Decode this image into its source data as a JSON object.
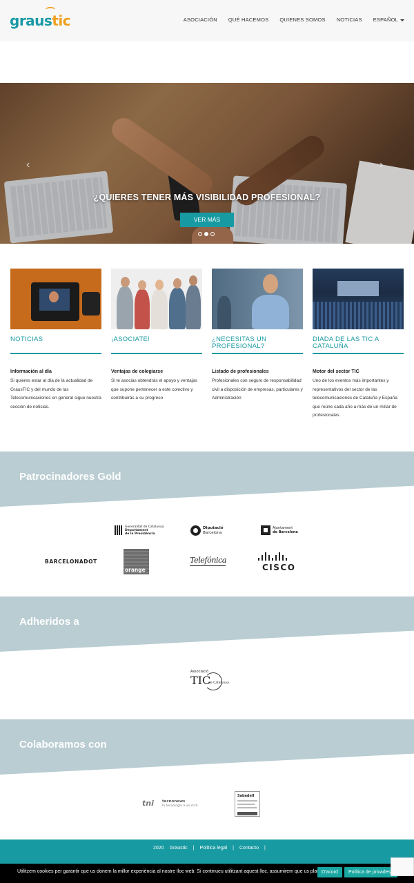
{
  "header": {
    "logo_part1": "graus",
    "logo_part2": "tic",
    "nav": [
      "ASOCIACIÓN",
      "QUÉ HACEMOS",
      "QUIENES SOMOS",
      "NOTICIAS",
      "ESPAÑOL"
    ]
  },
  "hero": {
    "title": "¿QUIERES TENER MÁS VISIBILIDAD PROFESIONAL?",
    "button": "VER MÁS",
    "slides": 3,
    "active_slide": 1
  },
  "cards": [
    {
      "title": "NOTICIAS",
      "subtitle": "Información al día",
      "text": "Si quieres estar al día de la actualidad de GrausTIC y del mundo de las Telecomunicaciones en general sigue nuestra sección de noticias."
    },
    {
      "title": "¡ASOCIATE!",
      "subtitle": "Ventajas de colegiarse",
      "text": "Si te asocias obtendrás el apoyo y ventajas que supone pertenecer a este colectivo y contribuirás a su progreso"
    },
    {
      "title": "¿NECESITAS UN PROFESIONAL?",
      "subtitle": "Listado de profesionales",
      "text": "Profesionales con seguro de responsabilidad civil a disposición de empresas, particulares y Administración"
    },
    {
      "title": "DIADA DE LAS TIC A CATALUÑA",
      "subtitle": "Motor del sector TIC",
      "text": "Uno de los eventos más importantes y representativos del sector de las telecomunicaciones de Cataluña y España que reúne cada año a más de un millar de profesionales"
    }
  ],
  "sponsors": {
    "title": "Patrocinadores Gold",
    "gencat_line1": "Generalitat de Catalunya",
    "gencat_line2": "Departament",
    "gencat_line3": "de la Presidència",
    "diba_line1": "Diputació",
    "diba_line2": "Barcelona",
    "ajbcn_line1": "Ajuntament",
    "ajbcn_line2": "de Barcelona",
    "barcelonadot": "BARCELONADOT",
    "orange": "orange",
    "telefonica": "Telefónica",
    "cisco": "CISCO"
  },
  "adheridos": {
    "title": "Adheridos a",
    "assoc_line1": "Associació",
    "assoc_line2": "TIC",
    "assoc_line3": "de Catalunya"
  },
  "colaboramos": {
    "title": "Colaboramos con",
    "tni": "tni",
    "tecnonews": "tecnonews",
    "tecnonews_tag": "la tecnología a un click",
    "sabadell": "Sabadell"
  },
  "footer": {
    "year": "2020",
    "brand": "Graustic",
    "legal": "Política legal",
    "contact": "Contacto",
    "sep": "|"
  },
  "cookie": {
    "text": "Utilitzem cookies per garantir que us donem la millor experiència al nostre lloc web. Si continueu utilitzant aquest lloc, assumirem que us plau.",
    "accept": "D'acord",
    "privacy": "Política de privadesa",
    "close": "✕"
  },
  "colors": {
    "accent": "#189aa2",
    "band": "#b9cdd2",
    "logo_orange": "#f0a020"
  }
}
